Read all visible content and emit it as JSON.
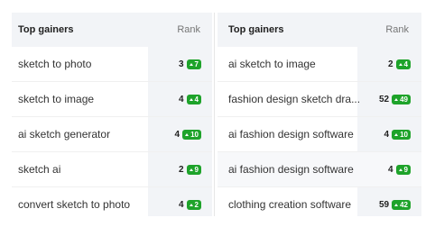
{
  "left_table": {
    "header": {
      "title": "Top gainers",
      "rank": "Rank"
    },
    "rows": [
      {
        "keyword": "sketch to photo",
        "rank": "3",
        "change": "7"
      },
      {
        "keyword": "sketch to image",
        "rank": "4",
        "change": "4"
      },
      {
        "keyword": "ai sketch generator",
        "rank": "4",
        "change": "10"
      },
      {
        "keyword": "sketch ai",
        "rank": "2",
        "change": "9"
      },
      {
        "keyword": "convert sketch to photo",
        "rank": "4",
        "change": "2"
      }
    ]
  },
  "right_table": {
    "header": {
      "title": "Top gainers",
      "rank": "Rank"
    },
    "rows": [
      {
        "keyword": "ai sketch to image",
        "rank": "2",
        "change": "4"
      },
      {
        "keyword": "fashion design sketch dra...",
        "rank": "52",
        "change": "49"
      },
      {
        "keyword": "ai fashion design software",
        "rank": "4",
        "change": "10"
      },
      {
        "keyword": "ai fashion design software",
        "rank": "4",
        "change": "9"
      },
      {
        "keyword": "clothing creation software",
        "rank": "59",
        "change": "42"
      }
    ]
  },
  "colors": {
    "badge": "#1ea32a",
    "header_bg": "#f2f4f7"
  },
  "icons": {
    "change": "caret-up-icon"
  }
}
